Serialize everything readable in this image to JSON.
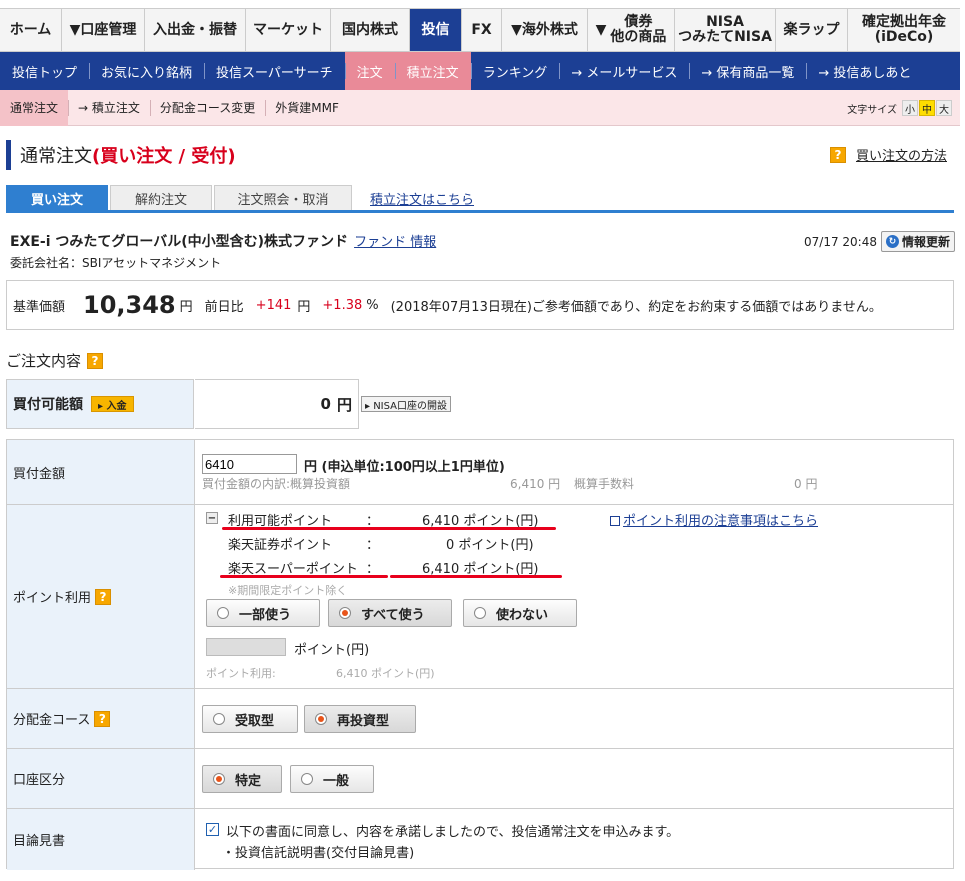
{
  "topnav": {
    "items": [
      {
        "label": "ホーム"
      },
      {
        "label": "▼口座管理"
      },
      {
        "label": "入出金・振替"
      },
      {
        "label": "マーケット"
      },
      {
        "label": "国内株式"
      },
      {
        "label": "投信"
      },
      {
        "label": "FX"
      },
      {
        "label": "▼海外株式"
      },
      {
        "label": "▼",
        "label2": "債券\n他の商品"
      },
      {
        "label": "NISA\nつみたてNISA"
      },
      {
        "label": "楽ラップ"
      },
      {
        "label": "確定拠出年金\n(iDeCo)"
      }
    ]
  },
  "subnav": {
    "items": [
      "投信トップ",
      "お気に入り銘柄",
      "投信スーパーサーチ",
      "注文",
      "積立注文",
      "ランキング",
      "→ メールサービス",
      "→ 保有商品一覧",
      "→ 投信あしあと"
    ]
  },
  "thirdnav": {
    "items": [
      "通常注文",
      "→ 積立注文",
      "分配金コース変更",
      "外貨建MMF"
    ],
    "fontsize_label": "文字サイズ",
    "fontsize_options": [
      "小",
      "中",
      "大"
    ]
  },
  "page": {
    "title_prefix": "通常注文",
    "title_red": "(買い注文 / 受付)",
    "help_icon": "?",
    "help_link": "買い注文の方法"
  },
  "tabs": {
    "items": [
      "買い注文",
      "解約注文",
      "注文照会・取消"
    ],
    "link": "積立注文はこちら"
  },
  "fund": {
    "name": "EXE-i つみたてグローバル(中小型含む)株式ファンド",
    "info_link": "ファンド 情報",
    "company": "委託会社名：SBIアセットマネジメント",
    "updated_at": "07/17 20:48",
    "update_button": "情報更新"
  },
  "price": {
    "label": "基準価額",
    "value": "10,348",
    "unit": "円",
    "change_label": "前日比",
    "change": "+141",
    "change_unit": "円",
    "change_pct": "+1.38",
    "pct_unit": "%",
    "note": "(2018年07月13日現在)ご参考価額であり、約定をお約束する価額ではありません。"
  },
  "order": {
    "section_title": "ご注文内容",
    "available_label": "買付可能額",
    "deposit_button": "▸ 入金",
    "available_value": "0",
    "available_unit": "円",
    "nisa_button": "▸ NISA口座の開設",
    "amount_label": "買付金額",
    "amount_value": "6410",
    "amount_note": "円 (申込単位:100円以上1円単位)",
    "breakdown_label": "買付金額の内訳:概算投資額",
    "breakdown_value": "6,410 円",
    "fee_label": "概算手数料",
    "fee_value": "0 円"
  },
  "points": {
    "label": "ポイント利用",
    "collapse_icon": "−",
    "available_label": "利用可能ポイント",
    "available_sep": "：",
    "available_value": "6,410 ポイント(円)",
    "rakuten_sec_label": "楽天証券ポイント",
    "rakuten_sec_sep": "：",
    "rakuten_sec_value": "0 ポイント(円)",
    "super_label": "楽天スーパーポイント",
    "super_sep": "：",
    "super_value": "6,410 ポイント(円)",
    "excl_note": "※期間限定ポイント除く",
    "notice_link": "ポイント利用の注意事項はこちら",
    "opt_partial": "一部使う",
    "opt_all": "すべて使う",
    "opt_none": "使わない",
    "input_unit": "ポイント(円)",
    "usage_label": "ポイント利用:",
    "usage_value": "6,410 ポイント(円)"
  },
  "dividend": {
    "label": "分配金コース",
    "opt_receive": "受取型",
    "opt_reinvest": "再投資型"
  },
  "account": {
    "label": "口座区分",
    "opt_specific": "特定",
    "opt_general": "一般"
  },
  "prospectus": {
    "label": "目論見書",
    "checkbox_mark": "✓",
    "agree_text": "以下の書面に同意し、内容を承諾しましたので、投信通常注文を申込みます。",
    "doc_text": "・投資信託説明書(交付目論見書)"
  },
  "colors": {
    "nav_blue": "#1c3f94",
    "accent_red": "#d8001c",
    "tab_blue": "#2f7fd0",
    "pink": "#e98a98"
  }
}
